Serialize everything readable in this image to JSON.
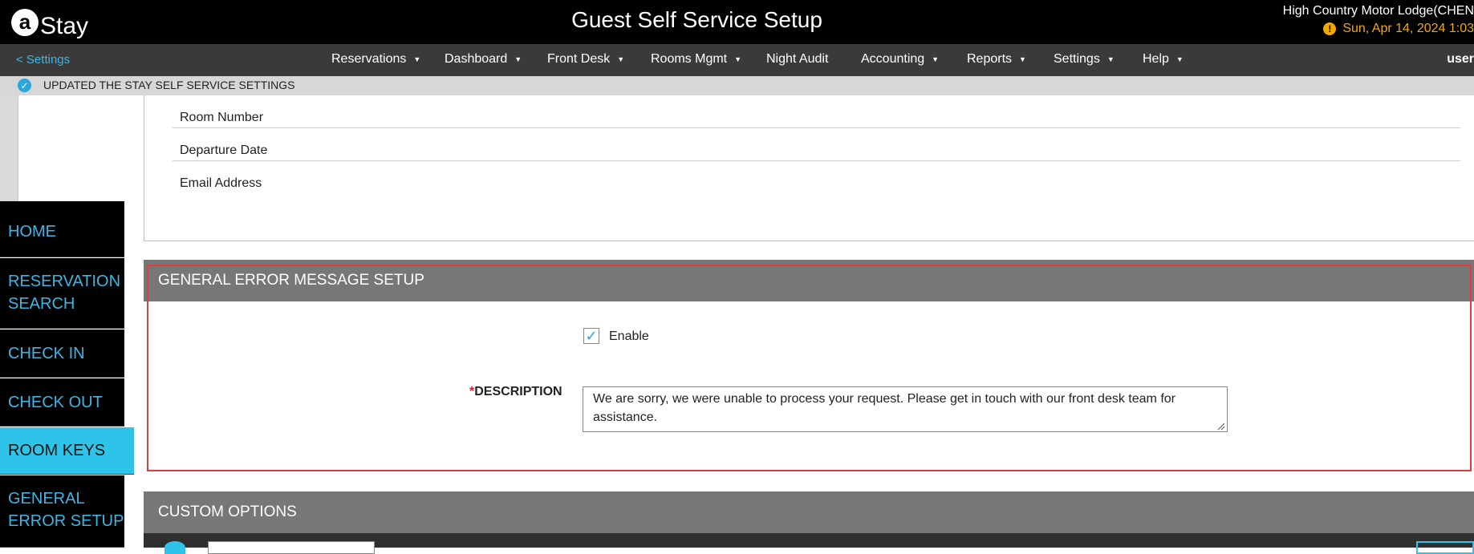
{
  "header": {
    "logo_text": "Stay",
    "title": "Guest Self Service Setup",
    "property": "High Country Motor Lodge(CHEN",
    "date": "Sun, Apr 14, 2024 1:03"
  },
  "nav": {
    "back": "< Settings",
    "items": [
      "Reservations",
      "Dashboard",
      "Front Desk",
      "Rooms Mgmt",
      "Night Audit",
      "Accounting",
      "Reports",
      "Settings",
      "Help"
    ],
    "user": "user"
  },
  "notification": {
    "text": "UPDATED THE STAY SELF SERVICE SETTINGS"
  },
  "fields": [
    "Room Number",
    "Departure Date",
    "Email Address"
  ],
  "sidebar": {
    "items": [
      {
        "label": "HOME"
      },
      {
        "label": "RESERVATION SEARCH"
      },
      {
        "label": "CHECK IN"
      },
      {
        "label": "CHECK OUT"
      },
      {
        "label": "ROOM KEYS"
      },
      {
        "label": "GENERAL ERROR SETUP"
      }
    ],
    "active": "ROOM KEYS"
  },
  "error_section": {
    "title": "GENERAL ERROR MESSAGE SETUP",
    "enable_label": "Enable",
    "enabled": true,
    "required_mark": "*",
    "description_label": "DESCRIPTION",
    "description_value": "We are sorry, we were unable to process your request. Please get in touch with our front desk team for assistance."
  },
  "custom_section": {
    "title": "CUSTOM OPTIONS"
  },
  "colors": {
    "accent": "#2ec4ea",
    "header_bg": "#000000",
    "nav_bg": "#3a3a3a",
    "section_header": "#777777",
    "highlight_border": "#e03c3c",
    "date_color": "#f2a900"
  }
}
